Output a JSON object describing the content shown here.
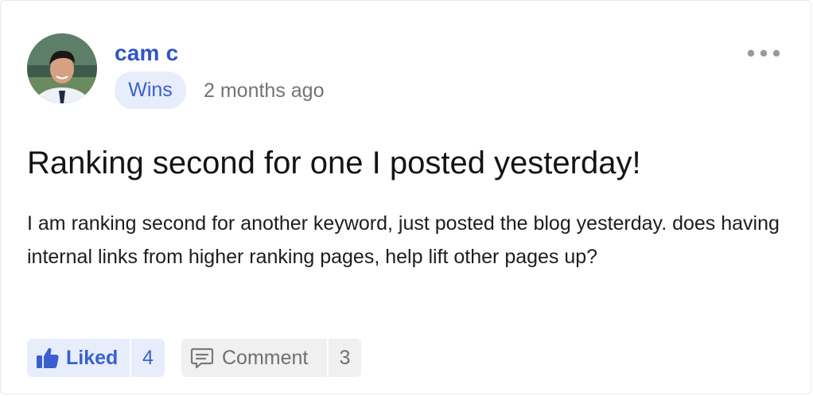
{
  "post": {
    "author_name": "cam c",
    "category": "Wins",
    "timestamp": "2 months ago",
    "title": "Ranking second for one I posted yesterday!",
    "body": "I am ranking second for another keyword, just posted the blog yesterday. does having internal links from higher ranking pages, help lift other pages up?"
  },
  "actions": {
    "like_label": "Liked",
    "like_count": "4",
    "like_state": "liked",
    "comment_label": "Comment",
    "comment_count": "3"
  },
  "icons": {
    "avatar": "avatar-photo",
    "more": "more-horizontal-icon",
    "like": "thumbs-up-icon",
    "comment": "speech-bubble-icon"
  },
  "colors": {
    "accent": "#2f55c9",
    "badge_bg": "#e7edfb",
    "muted_text": "#737373",
    "comment_bg": "#f0f0f1"
  }
}
